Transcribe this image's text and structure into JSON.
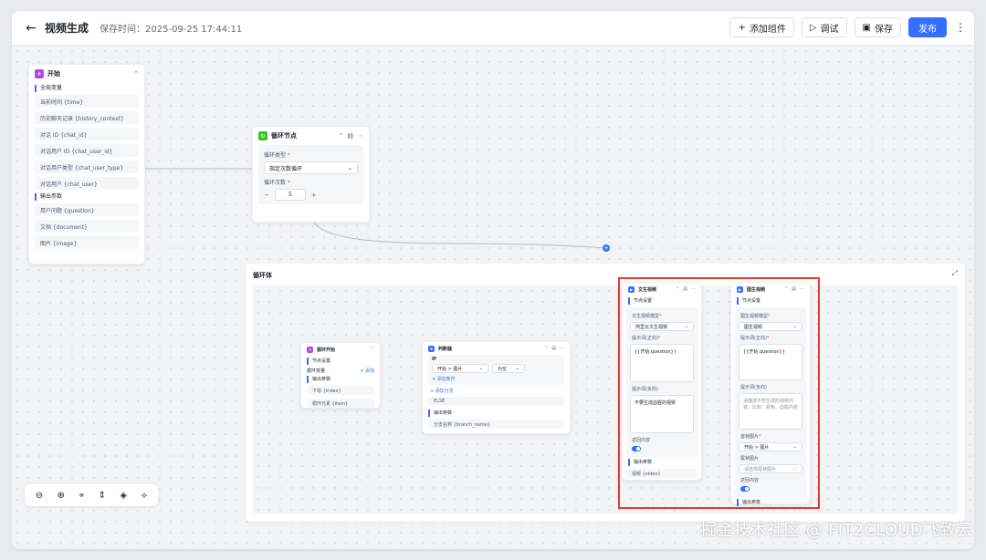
{
  "header": {
    "back_label": "←",
    "title": "视频生成",
    "save_time_label": "保存时间：2025-09-25 17:44:11",
    "add_component_label": "添加组件",
    "debug_label": "调试",
    "save_label": "保存",
    "publish_label": "发布",
    "more_label": "⋮",
    "colors": {
      "primary": "#3370ff"
    }
  },
  "start_node": {
    "title": "开始",
    "global_section": "全局变量",
    "global_items": [
      "当前时间 {time}",
      "历史聊天记录 {history_context}",
      "对话 ID {chat_id}",
      "对话用户 ID {chat_user_id}",
      "对话用户类型 {chat_user_type}",
      "对话用户 {chat_user}"
    ],
    "output_section": "输出参数",
    "output_items": [
      "用户问题 {question}",
      "文档 {document}",
      "图片 {image}"
    ]
  },
  "loop_node": {
    "title": "循环节点",
    "type_label": "循环类型",
    "type_value": "指定次数循环",
    "count_label": "循环次数",
    "count_value": "5"
  },
  "loop_body": {
    "title": "循环体",
    "loop_start": {
      "title": "循环开始",
      "section": "节点设置",
      "var_label": "循环变量",
      "add_label": "+ 添加",
      "output_section": "输出参数",
      "items": [
        "下标 {index}",
        "循环元素 {item}"
      ]
    },
    "judge": {
      "title": "判断器",
      "if_label": "IF",
      "cond_field": "开始 > 图片",
      "cond_op": "为空",
      "add_cond": "+ 添加条件",
      "add_branch": "+ 添加分支",
      "else_label": "ELSE",
      "output_section": "输出参数",
      "output_item": "分支名称 {branch_name}"
    },
    "text_video": {
      "title": "文生视频",
      "section": "节点设置",
      "model_label": "文生视频模型",
      "model_value": "阿里云文生视频",
      "prompt_label": "提示词(正向)",
      "prompt_value": "{{开始.question}}",
      "neg_label": "提示词(负向)",
      "neg_value": "不要生成血腥的视频",
      "return_label": "返回内容",
      "output_section": "输出参数",
      "output_item": "视频 {video}"
    },
    "image_video": {
      "title": "图生视频",
      "section": "节点设置",
      "model_label": "图生视频模型",
      "model_value": "图生视频",
      "prompt_label": "提示词(正向)",
      "prompt_value": "{{开始.question}}",
      "neg_label": "提示词(负向)",
      "neg_placeholder": "请描述不想生成的视频内容，比如：颜色、血腥内容",
      "first_frame_label": "首帧图片",
      "first_frame_value": "开始 > 图片",
      "last_frame_label": "尾帧图片",
      "last_frame_placeholder": "请选择尾帧图片",
      "return_label": "返回内容",
      "output_section": "输出参数"
    }
  },
  "zoombar": {
    "zoom_out": "⊖",
    "zoom_in": "⊕",
    "fit": "⌖",
    "layout": "⇕",
    "center": "◈",
    "collapse": "⟡"
  },
  "watermark": "掘金技术社区 @ FIT2CLOUD飞致云"
}
